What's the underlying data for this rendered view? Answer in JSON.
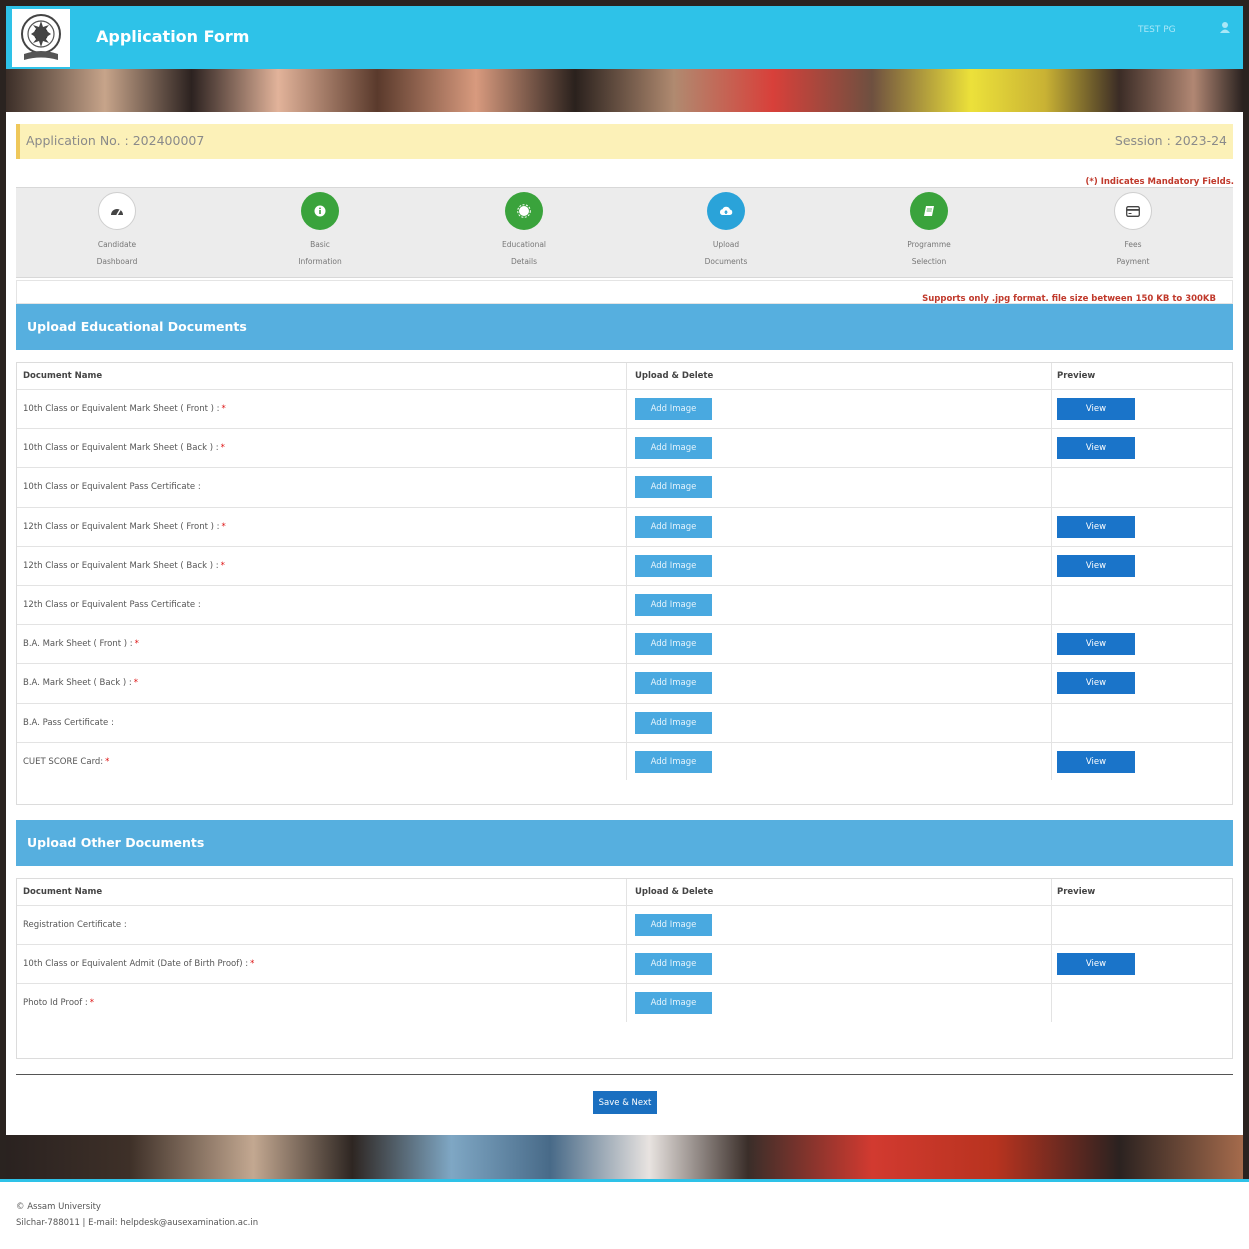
{
  "header": {
    "title": "Application Form",
    "user": "TEST PG"
  },
  "application": {
    "number_label": "Application No. : 202400007",
    "session_label": "Session : 2023-24",
    "mandatory_note": "(*) Indicates Mandatory Fields."
  },
  "steps": [
    {
      "line1": "Candidate",
      "line2": "Dashboard",
      "icon": "dashboard-icon",
      "state": "white"
    },
    {
      "line1": "Basic",
      "line2": "Information",
      "icon": "info-icon",
      "state": "green"
    },
    {
      "line1": "Educational",
      "line2": "Details",
      "icon": "certificate-icon",
      "state": "green"
    },
    {
      "line1": "Upload",
      "line2": "Documents",
      "icon": "cloud-upload-icon",
      "state": "blue"
    },
    {
      "line1": "Programme",
      "line2": "Selection",
      "icon": "book-icon",
      "state": "green"
    },
    {
      "line1": "Fees",
      "line2": "Payment",
      "icon": "credit-card-icon",
      "state": "white"
    }
  ],
  "supports_note": "Supports only .jpg format.  file size between 150 KB to 300KB",
  "columns": {
    "doc": "Document Name",
    "upload": "Upload  &  Delete",
    "preview": "Preview"
  },
  "buttons": {
    "add": "Add Image",
    "view": "View",
    "save": "Save & Next"
  },
  "educational": {
    "title": "Upload Educational Documents",
    "rows": [
      {
        "name": "10th Class or Equivalent  Mark Sheet ( Front ) :",
        "req": "*",
        "view": true
      },
      {
        "name": "10th Class or Equivalent  Mark Sheet ( Back ) :",
        "req": "*",
        "view": true
      },
      {
        "name": "10th Class or Equivalent Pass Certificate   :",
        "req": "",
        "view": false
      },
      {
        "name": "12th Class or Equivalent  Mark Sheet ( Front ) :",
        "req": "*",
        "view": true
      },
      {
        "name": "12th Class or Equivalent  Mark Sheet ( Back ) :",
        "req": "*",
        "view": true
      },
      {
        "name": "12th Class or Equivalent Pass Certificate   :",
        "req": "",
        "view": false
      },
      {
        "name": "B.A.  Mark Sheet ( Front ) :",
        "req": "*",
        "view": true
      },
      {
        "name": "B.A.  Mark Sheet ( Back ) :",
        "req": "*",
        "view": true
      },
      {
        "name": "B.A. Pass Certificate   :",
        "req": "",
        "view": false
      },
      {
        "name": "CUET SCORE Card:",
        "req": "*",
        "view": true
      }
    ]
  },
  "other": {
    "title": "Upload Other Documents",
    "rows": [
      {
        "name": "Registration Certificate  :",
        "req": "",
        "view": false
      },
      {
        "name": "10th Class or Equivalent Admit (Date of Birth Proof)  :",
        "req": "*",
        "view": true
      },
      {
        "name": "Photo Id Proof  :",
        "req": "*",
        "view": false
      }
    ]
  },
  "footer": {
    "copyright": "© Assam University",
    "contact": "Silchar-788011 | E-mail: helpdesk@ausexamination.ac.in"
  },
  "colors": {
    "header": "#2ec2e8",
    "section": "#56afdf",
    "add_button": "#49a9e0",
    "view_button": "#1a74c9",
    "required": "#d11111",
    "step_green": "#3aa33c",
    "step_blue": "#2aa3d9"
  }
}
